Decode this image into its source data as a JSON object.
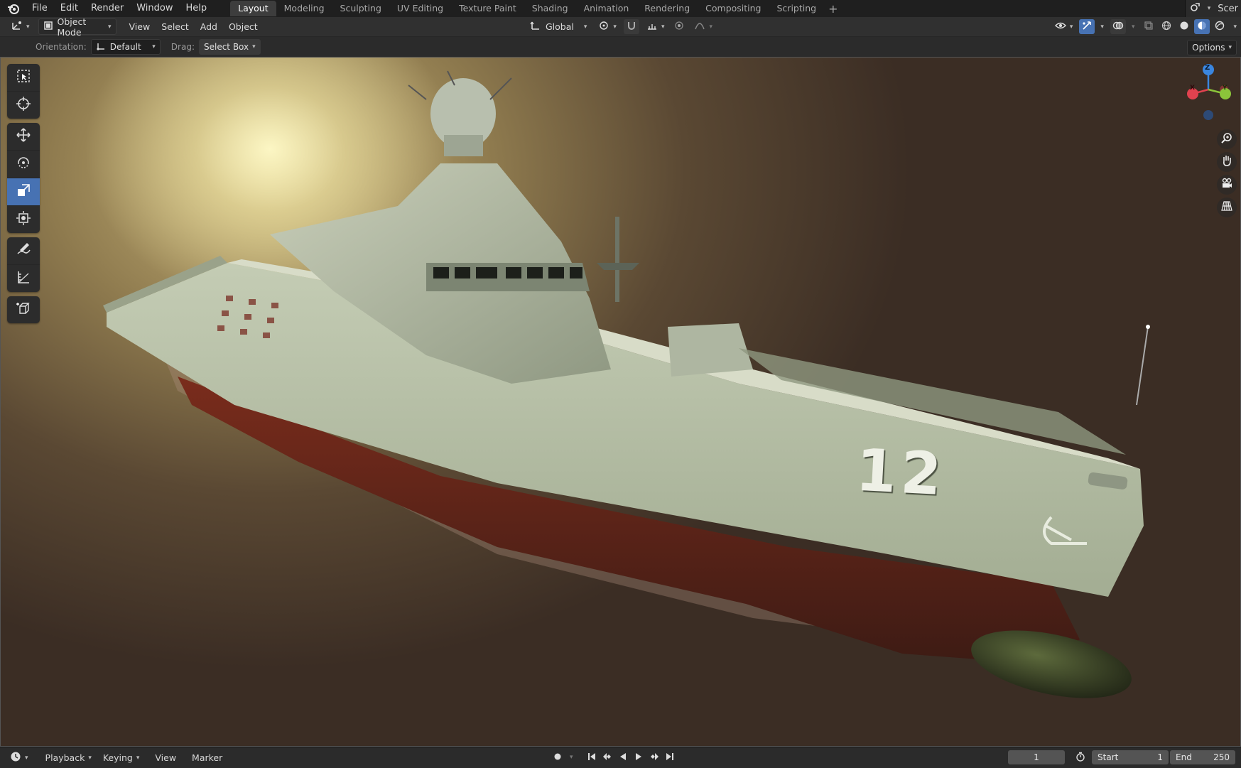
{
  "menu": {
    "items": [
      "File",
      "Edit",
      "Render",
      "Window",
      "Help"
    ]
  },
  "workspaces": {
    "tabs": [
      "Layout",
      "Modeling",
      "Sculpting",
      "UV Editing",
      "Texture Paint",
      "Shading",
      "Animation",
      "Rendering",
      "Compositing",
      "Scripting"
    ],
    "active": "Layout",
    "add_label": "+"
  },
  "scene": {
    "label": "Scer"
  },
  "header": {
    "mode_label": "Object Mode",
    "view_label": "View",
    "select_label": "Select",
    "add_label": "Add",
    "object_label": "Object",
    "transform_orientation": "Global"
  },
  "tool_settings": {
    "orientation_label": "Orientation:",
    "orientation_value": "Default",
    "drag_label": "Drag:",
    "drag_value": "Select Box",
    "options_label": "Options"
  },
  "viewport": {
    "hull_number": "12",
    "gizmo": {
      "z_label": "Z",
      "x_label": "X",
      "y_label": "Y",
      "colors": {
        "x": "#e0424f",
        "y": "#8bc43a",
        "z": "#3a86e0"
      }
    }
  },
  "timeline": {
    "playback_label": "Playback",
    "keying_label": "Keying",
    "view_label": "View",
    "marker_label": "Marker",
    "current_frame": "1",
    "start_label": "Start",
    "start_value": "1",
    "end_label": "End",
    "end_value": "250"
  },
  "colors": {
    "accent": "#4772b3",
    "ship_hull": "#b7c2a7",
    "ship_lower_hull": "#6b2a1d",
    "bg_dark": "#1f1f1f"
  }
}
